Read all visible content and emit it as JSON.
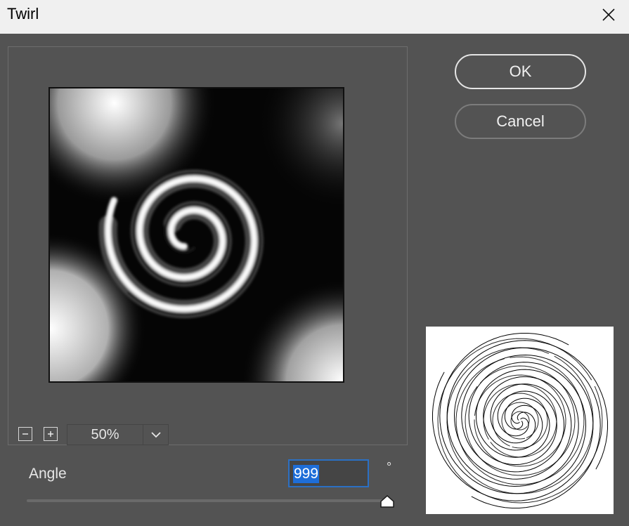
{
  "dialog": {
    "title": "Twirl",
    "close_icon": "close-icon"
  },
  "buttons": {
    "ok_label": "OK",
    "cancel_label": "Cancel"
  },
  "preview": {
    "zoom_out_icon": "minus-icon",
    "zoom_in_icon": "plus-icon",
    "zoom_value": "50%",
    "zoom_dropdown_icon": "chevron-down-icon"
  },
  "angle": {
    "label": "Angle",
    "value": "999",
    "unit": "°",
    "slider_fraction": 1.0
  },
  "colors": {
    "dialog_background": "#535353",
    "titlebar_background": "#f0f0f0",
    "input_focus_border": "#2b70c4",
    "selection_highlight": "#1e6ed8"
  }
}
